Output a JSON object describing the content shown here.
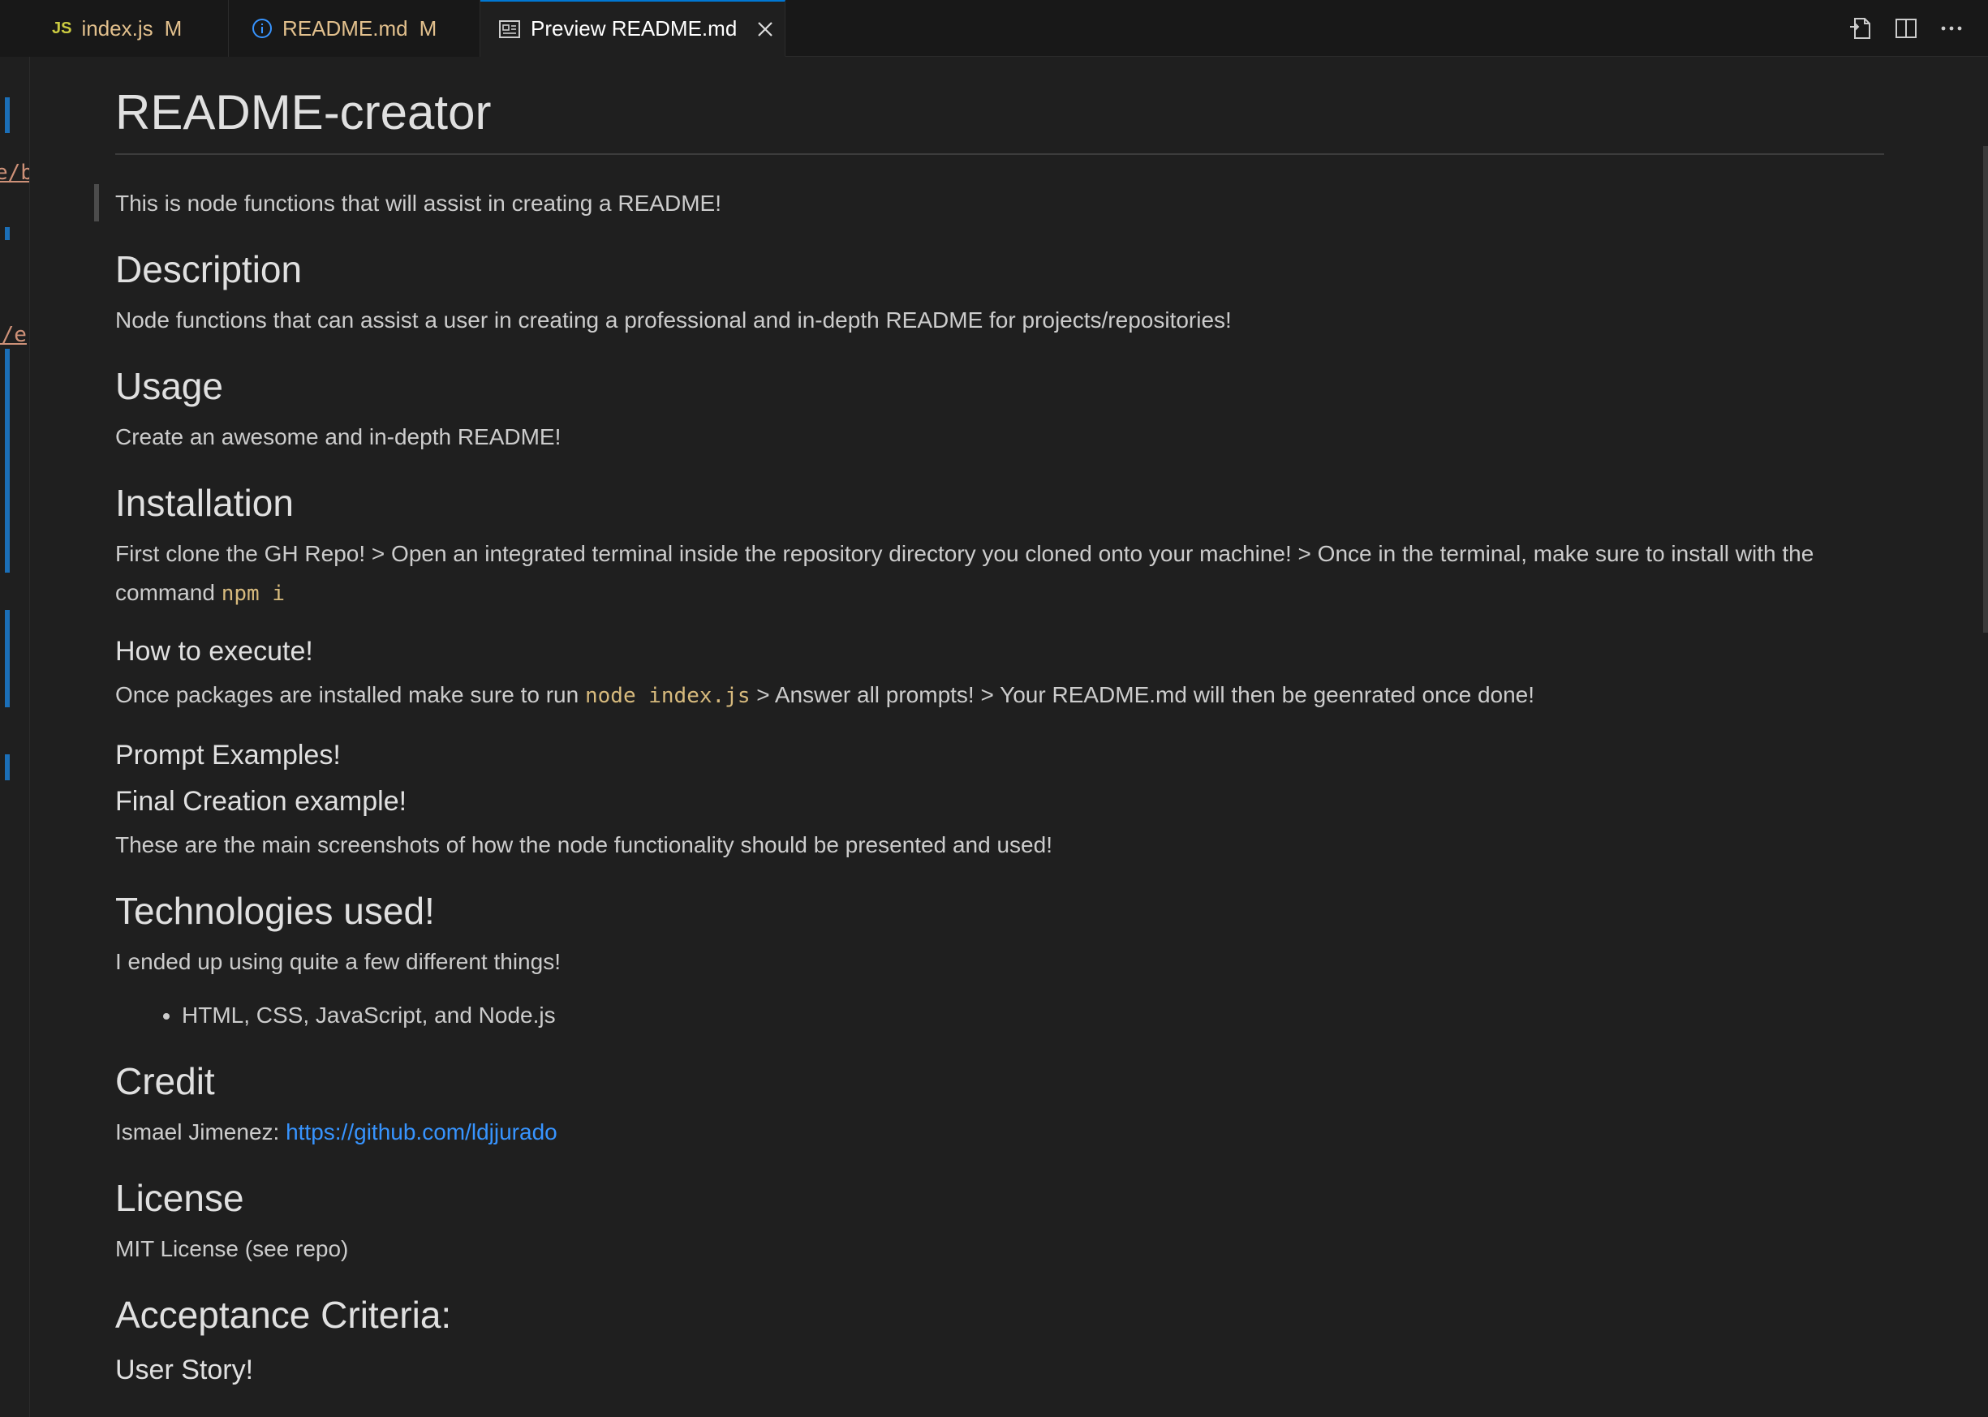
{
  "tabs": {
    "index_js": {
      "icon_text": "JS",
      "label": "index.js",
      "status": "M",
      "icon": "js-file-icon"
    },
    "readme": {
      "label": "README.md",
      "status": "M",
      "icon": "info-icon"
    },
    "preview": {
      "label": "Preview README.md",
      "icon": "preview-icon",
      "close_icon": "close-icon"
    }
  },
  "actions": [
    {
      "icon": "open-source-icon"
    },
    {
      "icon": "split-editor-icon"
    },
    {
      "icon": "more-actions-icon"
    }
  ],
  "gutter": {
    "snippet_1": "e/b",
    "snippet_2": "n/e"
  },
  "readme": {
    "title": "README-creator",
    "intro": "This is node functions that will assist in creating a README!",
    "description_heading": "Description",
    "description_text": "Node functions that can assist a user in creating a professional and in-depth README for projects/repositories!",
    "usage_heading": "Usage",
    "usage_text": "Create an awesome and in-depth README!",
    "installation_heading": "Installation",
    "installation_text": "First clone the GH Repo! > Open an integrated terminal inside the repository directory you cloned onto your machine! > Once in the terminal, make sure to install with the command ",
    "installation_code": "npm i",
    "execute_heading": "How to execute!",
    "execute_text_before": "Once packages are installed make sure to run ",
    "execute_code": "node index.js",
    "execute_text_after": " > Answer all prompts! > Your README.md will then be geenrated once done!",
    "prompt_heading": "Prompt Examples!",
    "final_heading": "Final Creation example!",
    "final_text": "These are the main screenshots of how the node functionality should be presented and used!",
    "tech_heading": "Technologies used!",
    "tech_text": "I ended up using quite a few different things!",
    "tech_list": [
      "HTML, CSS, JavaScript, and Node.js"
    ],
    "credit_heading": "Credit",
    "credit_name": "Ismael Jimenez: ",
    "credit_link": "https://github.com/ldjjurado",
    "license_heading": "License",
    "license_text": "MIT License (see repo)",
    "acceptance_heading": "Acceptance Criteria:",
    "user_story_heading": "User Story!"
  }
}
